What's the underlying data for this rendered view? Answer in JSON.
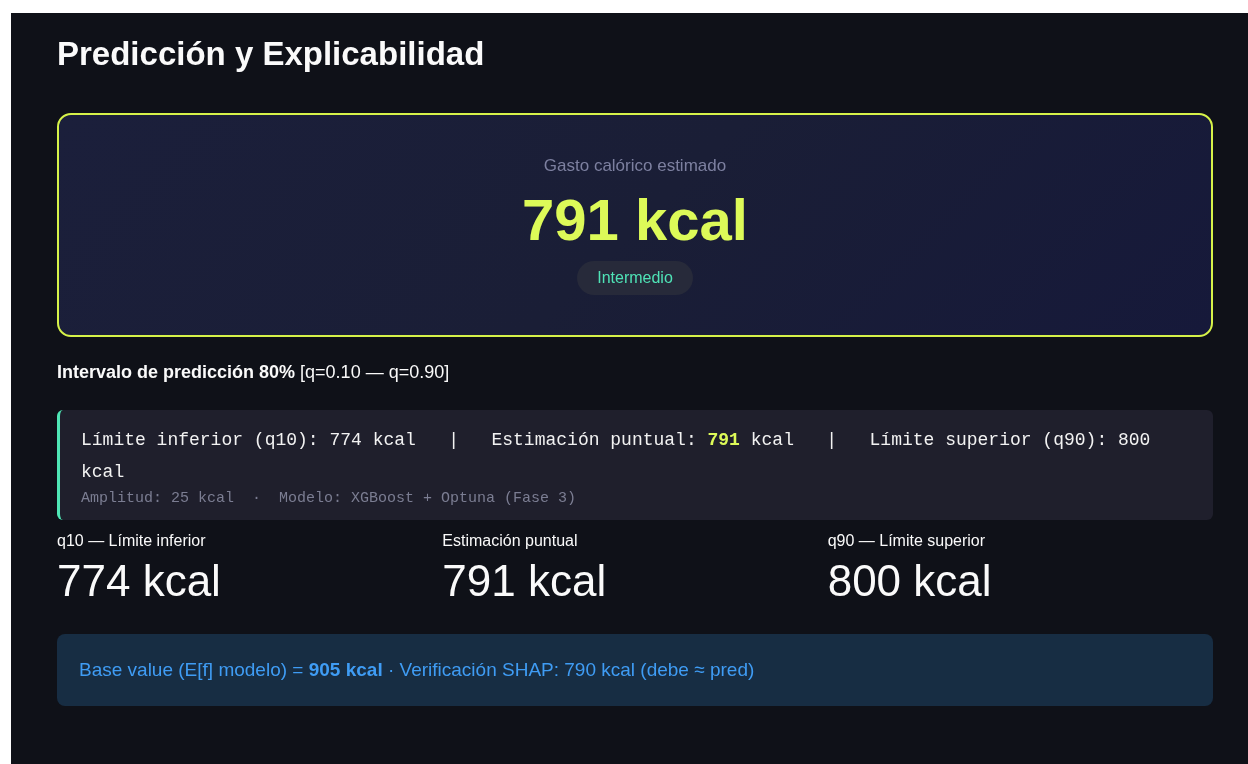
{
  "title": "Predicción y Explicabilidad",
  "hero": {
    "label": "Gasto calórico estimado",
    "value": "791 kcal",
    "badge": "Intermedio"
  },
  "interval": "**Intervalo de predicción 80%** [q=0.10 — q=0.90]",
  "summary": {
    "line": "Límite inferior (q10): 774 kcal   |   Estimación puntual: **791** kcal   |   Límite superior (q90): 800 kcal",
    "meta": "Amplitud: 25 kcal  ·  Modelo: XGBoost + Optuna (Fase 3)"
  },
  "metrics": [
    {
      "label": "q10 — Límite inferior",
      "value": "774 kcal"
    },
    {
      "label": "Estimación puntual",
      "value": "791 kcal"
    },
    {
      "label": "q90 — Límite superior",
      "value": "800 kcal"
    }
  ],
  "info": "Base value (E[f] modelo) = **905 kcal** · Verificación SHAP: 790 kcal (debe ≈ pred)"
}
